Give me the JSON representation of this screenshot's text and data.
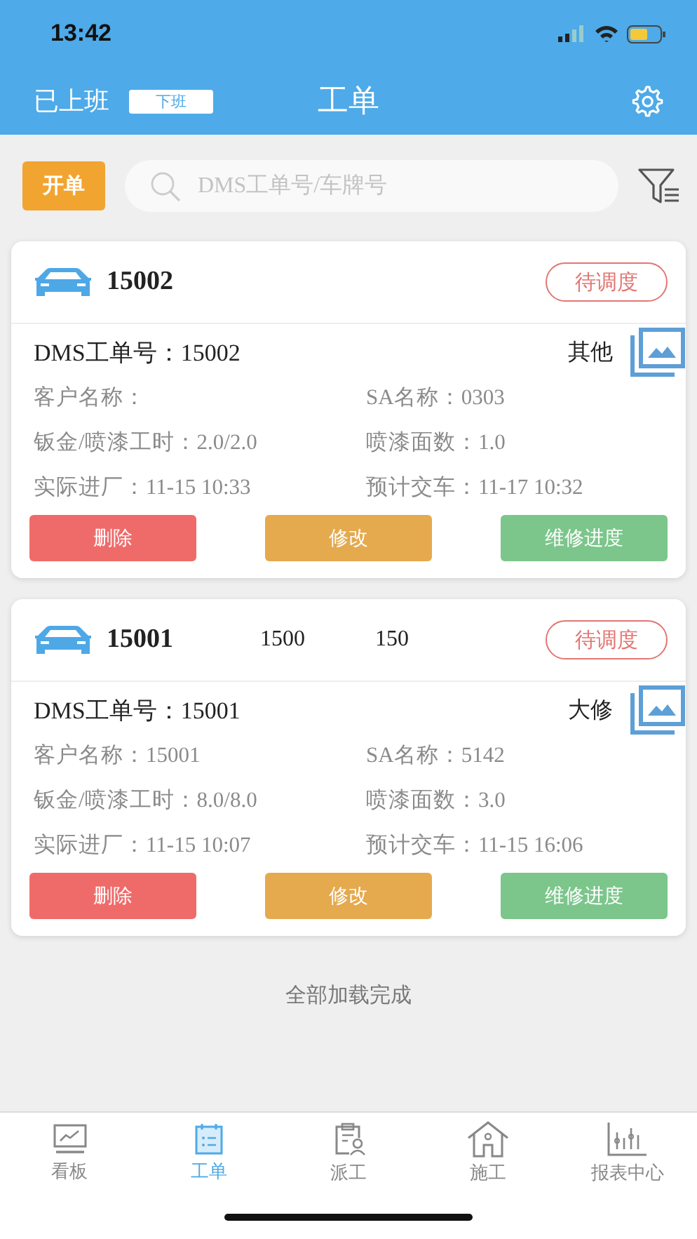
{
  "status_bar": {
    "time": "13:42"
  },
  "header": {
    "duty_status": "已上班",
    "off_duty_button": "下班",
    "title": "工单"
  },
  "toolbar": {
    "open_button": "开单",
    "search": {
      "placeholder": "DMS工单号/车牌号"
    }
  },
  "orders": [
    {
      "plate": "15002",
      "status": "待调度",
      "dms_label": "DMS工单号：",
      "dms_value": "15002",
      "type": "其他",
      "fields": [
        {
          "label": "客户名称："
        },
        {
          "label": "SA名称：",
          "value": "0303"
        },
        {
          "label": "钣金/喷漆工时：",
          "value": "2.0/2.0"
        },
        {
          "label": "喷漆面数：",
          "value": "1.0"
        },
        {
          "label": "实际进厂：",
          "value": "11-15 10:33"
        },
        {
          "label": "预计交车：",
          "value": "11-17 10:32"
        }
      ],
      "buttons": [
        {
          "label": "删除",
          "kind": "delete"
        },
        {
          "label": "修改",
          "kind": "edit"
        },
        {
          "label": "维修进度",
          "kind": "progress"
        }
      ]
    },
    {
      "plate": "15001",
      "extras": [
        "1500",
        "150"
      ],
      "status": "待调度",
      "dms_label": "DMS工单号：",
      "dms_value": "15001",
      "type": "大修",
      "fields": [
        {
          "label": "客户名称：",
          "value": "15001"
        },
        {
          "label": "SA名称：",
          "value": "5142"
        },
        {
          "label": "钣金/喷漆工时：",
          "value": "8.0/8.0"
        },
        {
          "label": "喷漆面数：",
          "value": "3.0"
        },
        {
          "label": "实际进厂：",
          "value": "11-15 10:07"
        },
        {
          "label": "预计交车：",
          "value": "11-15 16:06"
        }
      ],
      "buttons": [
        {
          "label": "删除",
          "kind": "delete"
        },
        {
          "label": "修改",
          "kind": "edit"
        },
        {
          "label": "维修进度",
          "kind": "progress"
        }
      ]
    }
  ],
  "footer_note": "全部加载完成",
  "tabs": [
    {
      "label": "看板",
      "kind": "board",
      "selected": false
    },
    {
      "label": "工单",
      "kind": "orders",
      "selected": true
    },
    {
      "label": "派工",
      "kind": "dispatch",
      "selected": false
    },
    {
      "label": "施工",
      "kind": "build",
      "selected": false
    },
    {
      "label": "报表中心",
      "kind": "reports",
      "selected": false
    }
  ]
}
